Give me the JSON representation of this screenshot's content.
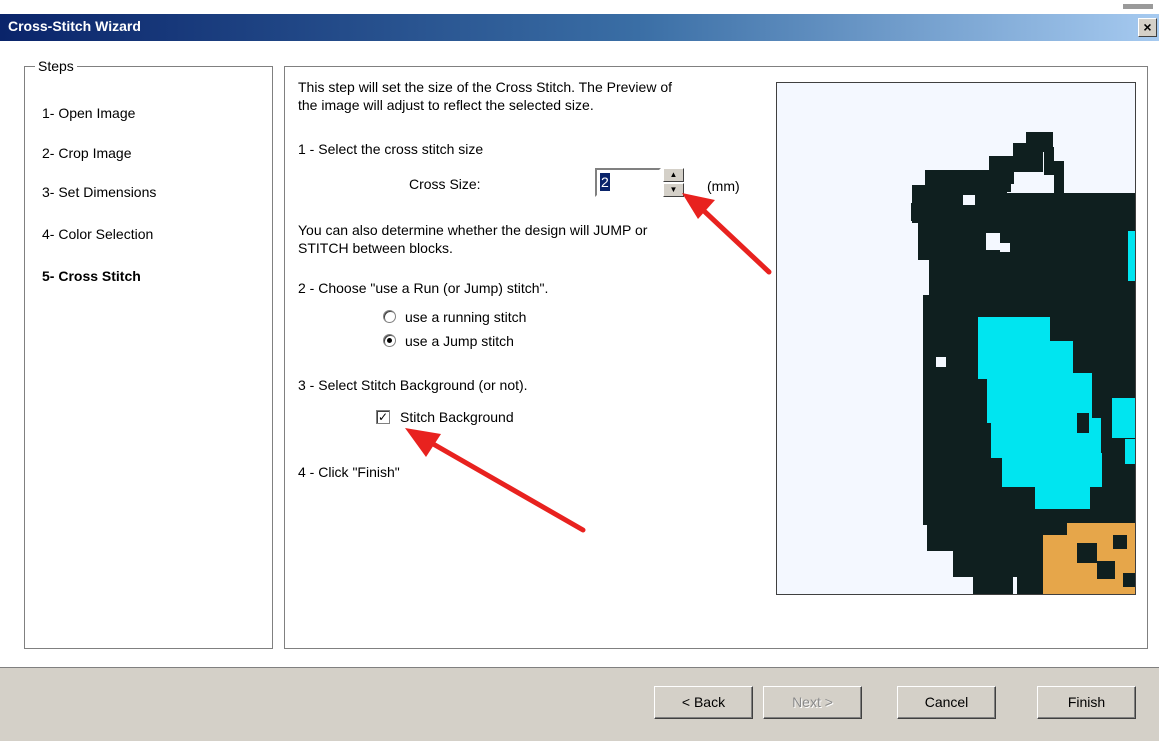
{
  "window": {
    "title": "Cross-Stitch Wizard",
    "close_label": "×"
  },
  "steps": {
    "legend": "Steps",
    "items": [
      {
        "label": "1- Open Image",
        "active": false
      },
      {
        "label": "2- Crop Image",
        "active": false
      },
      {
        "label": "3- Set Dimensions",
        "active": false
      },
      {
        "label": "4- Color Selection",
        "active": false
      },
      {
        "label": "5- Cross Stitch",
        "active": true
      }
    ]
  },
  "main": {
    "intro_line1": "This step will set the size of the Cross Stitch. The Preview of",
    "intro_line2": "the image will adjust to reflect the selected size.",
    "step1_label": "1 -  Select the cross stitch size",
    "cross_size_label": "Cross Size:",
    "cross_size_value": "2",
    "cross_size_unit": "(mm)",
    "jump_text_line1": "You can also determine whether the design will JUMP or",
    "jump_text_line2": "STITCH between blocks.",
    "step2_label": "2 -  Choose \"use a Run (or Jump) stitch\".",
    "radio_running_label": "use a running stitch",
    "radio_jump_label": "use a Jump stitch",
    "selected_stitch": "jump",
    "step3_label": "3 -  Select Stitch Background (or not).",
    "stitch_background_label": "Stitch Background",
    "stitch_background_checked": true,
    "step4_label": "4 -  Click \"Finish\""
  },
  "preview": {
    "colors": {
      "background": "#f4f8ff",
      "dark": "#0f1f1f",
      "cyan": "#00e5f0",
      "orange": "#e6a64a"
    }
  },
  "buttons": {
    "back": "< Back",
    "next": "Next >",
    "cancel": "Cancel",
    "finish": "Finish"
  },
  "annotations": {
    "arrow_color": "#e8221f"
  }
}
